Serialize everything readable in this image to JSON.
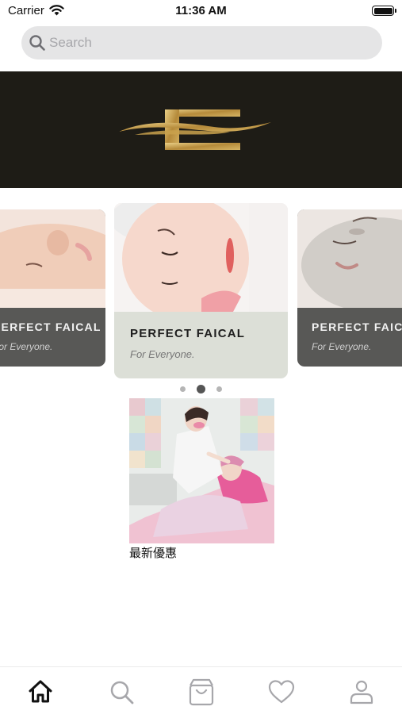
{
  "status_bar": {
    "carrier": "Carrier",
    "time": "11:36 AM",
    "wifi_icon": "wifi-icon",
    "battery_icon": "battery-icon"
  },
  "search": {
    "placeholder": "Search",
    "value": "",
    "icon": "search-icon"
  },
  "banner": {
    "logo": "gold-letter-E-logo",
    "background_color": "#1e1c16",
    "logo_color": "#c4a050"
  },
  "carousel": {
    "cards": [
      {
        "title": "PERFECT FAICAL",
        "subtitle": "For Everyone.",
        "position": "left-partial"
      },
      {
        "title": "PERFECT FAICAL",
        "subtitle": "For Everyone.",
        "position": "center"
      },
      {
        "title": "PERFECT FAICAL",
        "subtitle": "For Everyone.",
        "position": "right-partial"
      }
    ],
    "page_count": 3,
    "active_page": 2
  },
  "promo": {
    "caption": "最新優惠"
  },
  "tabbar": {
    "tabs": [
      {
        "icon": "home-icon",
        "active": true
      },
      {
        "icon": "search-icon",
        "active": false
      },
      {
        "icon": "shopping-bag-icon",
        "active": false
      },
      {
        "icon": "heart-icon",
        "active": false
      },
      {
        "icon": "profile-icon",
        "active": false
      }
    ],
    "active_color": "#111111",
    "inactive_color": "#a7a7ab"
  }
}
